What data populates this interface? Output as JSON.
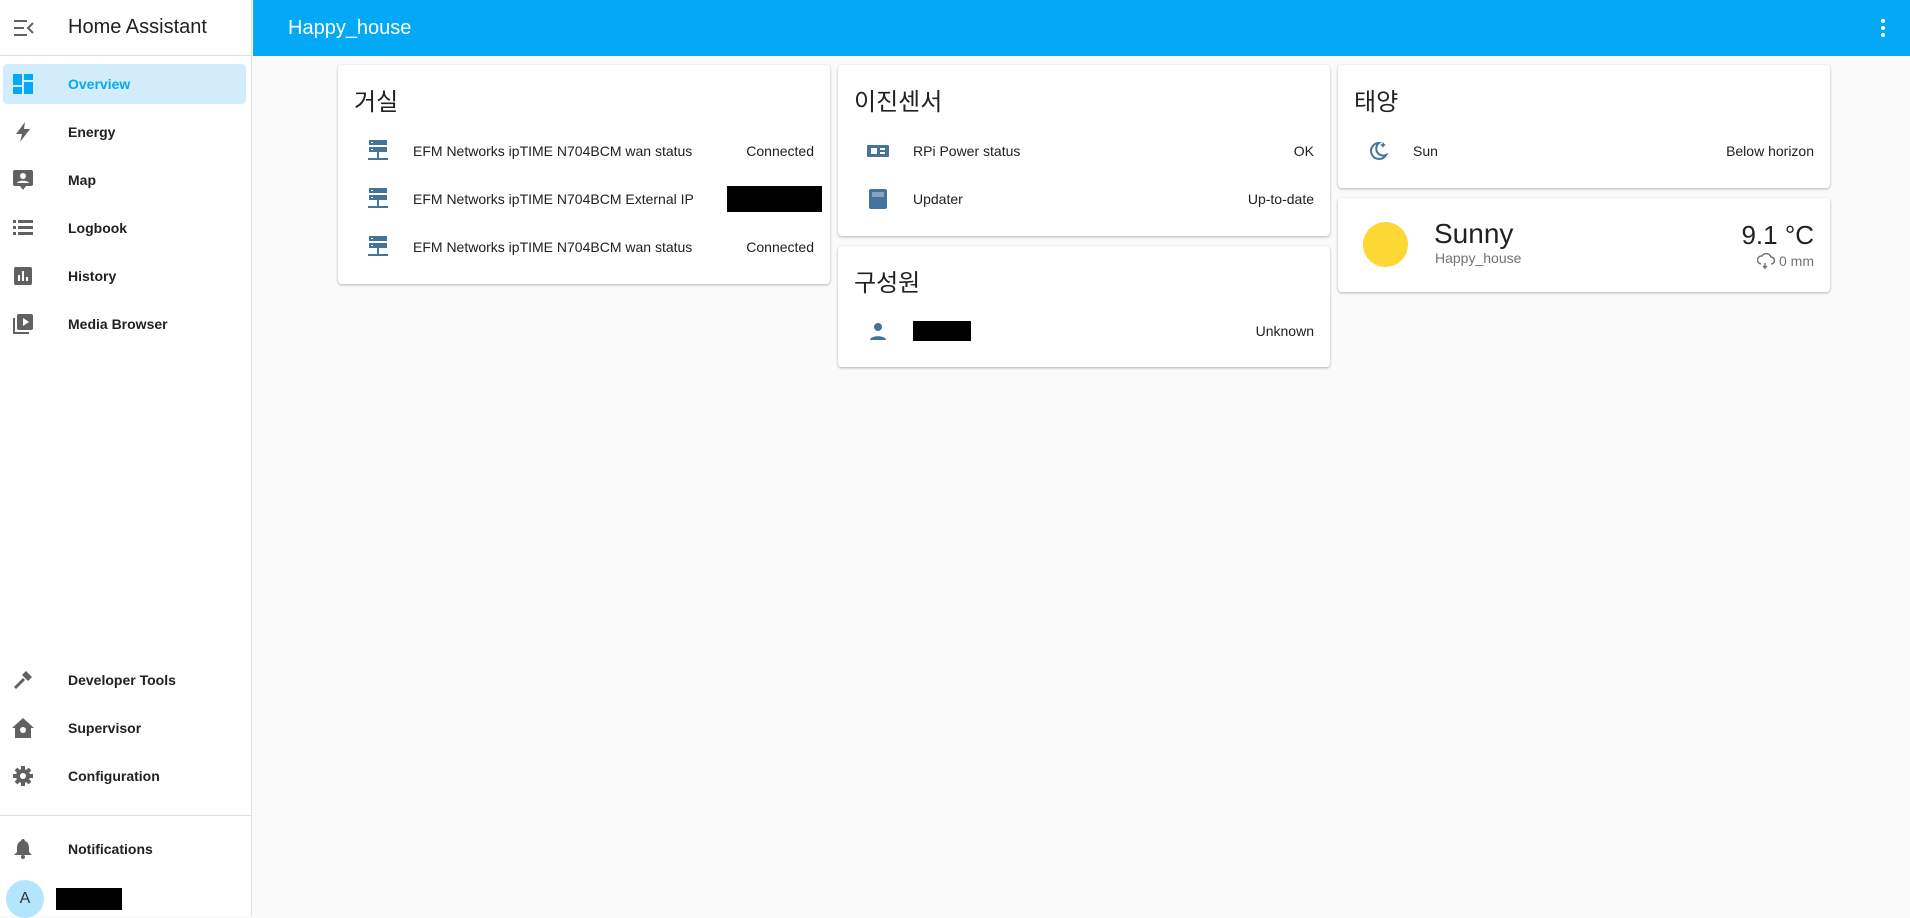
{
  "app": {
    "title": "Home Assistant"
  },
  "sidebar": {
    "items": [
      {
        "label": "Overview",
        "icon": "dashboard-icon",
        "active": true
      },
      {
        "label": "Energy",
        "icon": "lightning-bolt-icon"
      },
      {
        "label": "Map",
        "icon": "map-account-icon"
      },
      {
        "label": "Logbook",
        "icon": "logbook-list-icon"
      },
      {
        "label": "History",
        "icon": "chart-box-icon"
      },
      {
        "label": "Media Browser",
        "icon": "media-play-box-icon"
      }
    ],
    "bottom_items": [
      {
        "label": "Developer Tools",
        "icon": "hammer-icon"
      },
      {
        "label": "Supervisor",
        "icon": "supervisor-home-icon"
      },
      {
        "label": "Configuration",
        "icon": "gear-icon"
      }
    ],
    "notifications": {
      "label": "Notifications",
      "icon": "bell-icon"
    },
    "user": {
      "avatar_initial": "A"
    }
  },
  "header": {
    "title": "Happy_house"
  },
  "cards": {
    "living_room": {
      "title": "거실",
      "rows": [
        {
          "name": "EFM Networks ipTIME N704BCM wan status",
          "state": "Connected",
          "icon": "server-network-icon"
        },
        {
          "name": "EFM Networks ipTIME N704BCM External IP",
          "state": "",
          "icon": "server-network-icon"
        },
        {
          "name": "EFM Networks ipTIME N704BCM wan status",
          "state": "Connected",
          "icon": "server-network-icon"
        }
      ]
    },
    "binary_sensors": {
      "title": "이진센서",
      "rows": [
        {
          "name": "RPi Power status",
          "state": "OK",
          "icon": "raspberry-pi-icon"
        },
        {
          "name": "Updater",
          "state": "Up-to-date",
          "icon": "package-icon"
        }
      ]
    },
    "members": {
      "title": "구성원",
      "rows": [
        {
          "name": "",
          "state": "Unknown",
          "icon": "person-icon"
        }
      ]
    },
    "sun": {
      "title": "태양",
      "rows": [
        {
          "name": "Sun",
          "state": "Below horizon",
          "icon": "moon-stars-icon"
        }
      ]
    },
    "weather": {
      "condition": "Sunny",
      "location": "Happy_house",
      "temperature": "9.1 °C",
      "precipitation": "0 mm",
      "icon": "sun-icon",
      "precip_icon": "weather-rain-icon"
    }
  },
  "colors": {
    "primary": "#03a9f4",
    "icon": "#44739e",
    "active_bg": "#d3ecfb",
    "sun": "#fdd835"
  }
}
